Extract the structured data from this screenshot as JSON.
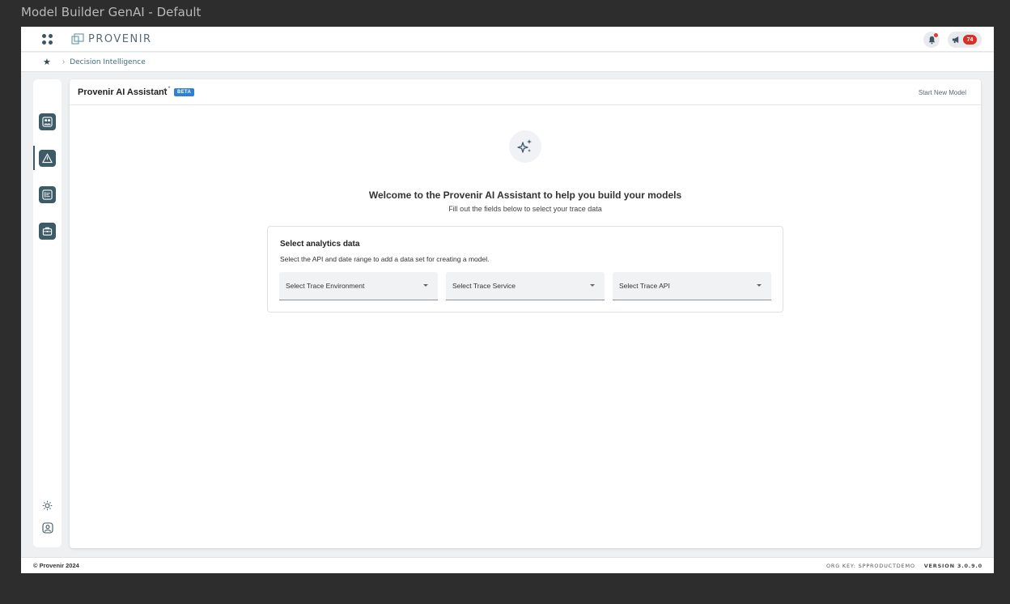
{
  "window": {
    "title": "Model Builder GenAI - Default"
  },
  "header": {
    "logo_text": "PROVENIR",
    "notification_count": "74",
    "icons": {
      "apps": "grid-dots-icon",
      "bell": "bell-icon",
      "announcements": "megaphone-icon"
    }
  },
  "breadcrumb": {
    "home_icon": "star-icon",
    "items": [
      "Decision Intelligence"
    ]
  },
  "sidebar": {
    "items": [
      {
        "icon": "team-icon"
      },
      {
        "icon": "warning-triangle-icon",
        "active": true
      },
      {
        "icon": "list-chart-icon"
      },
      {
        "icon": "briefcase-icon"
      }
    ],
    "bottom": [
      {
        "icon": "sun-icon"
      },
      {
        "icon": "user-profile-icon"
      }
    ]
  },
  "panel": {
    "title": "Provenir AI Assistant",
    "badge": "BETA",
    "action": "Start New Model",
    "welcome": "Welcome to the Provenir AI Assistant to help you build your models",
    "welcome_sub": "Fill out the fields below to select your trace data"
  },
  "analytics_card": {
    "title": "Select analytics data",
    "subtitle": "Select the API and date range to add a data set for creating a model.",
    "selects": [
      {
        "label": "Select Trace Environment"
      },
      {
        "label": "Select Trace Service"
      },
      {
        "label": "Select Trace API"
      }
    ]
  },
  "footer": {
    "copyright": "© Provenir 2024",
    "org_key": "ORG KEY: SPPRODUCTDEMO",
    "version": "VERSION 3.0.9.0"
  },
  "colors": {
    "accent": "#3d5a67",
    "beta": "#2f7fd6",
    "badge": "#d93025"
  }
}
